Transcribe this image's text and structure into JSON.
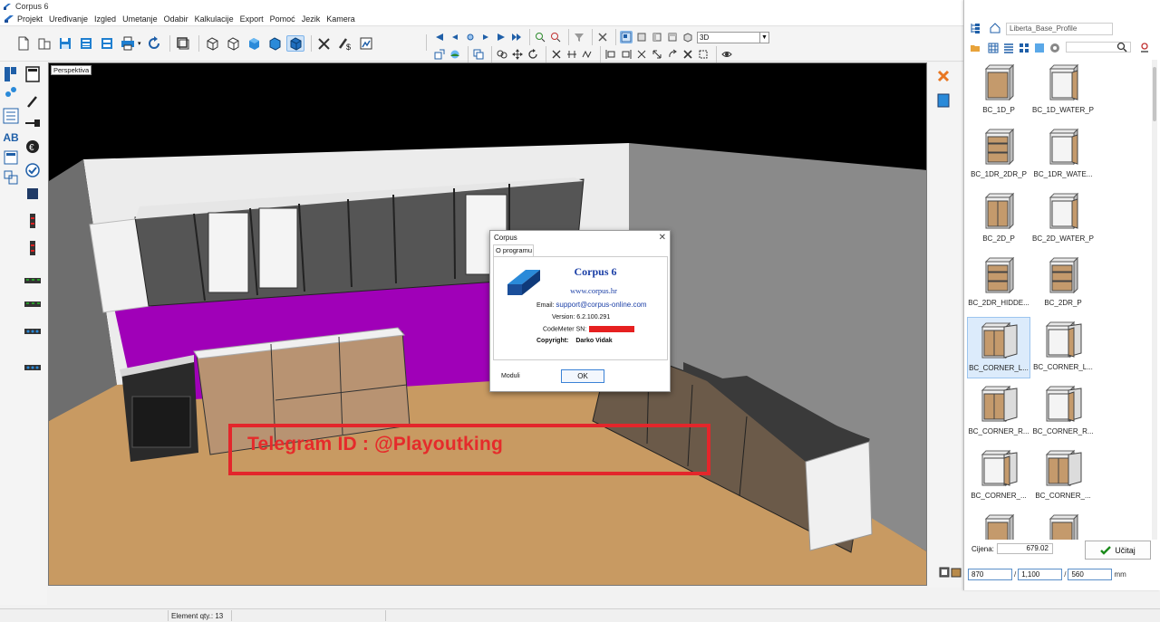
{
  "window": {
    "title": "Corpus 6"
  },
  "menu": [
    "Projekt",
    "Uređivanje",
    "Izgled",
    "Umetanje",
    "Odabir",
    "Kalkulacije",
    "Export",
    "Pomoć",
    "Jezik",
    "Kamera"
  ],
  "toolbar": {
    "view_mode": "3D"
  },
  "viewport": {
    "label": "Perspektiva"
  },
  "panel": {
    "profile": "Liberta_Base_Profile",
    "items": [
      {
        "label": "BC_1D_P",
        "icon": "cabinet-1-door-icon"
      },
      {
        "label": "BC_1D_WATER_P",
        "icon": "cabinet-1-door-open-icon"
      },
      {
        "label": "BC_1DR_2DR_P",
        "icon": "cabinet-drawers-icon"
      },
      {
        "label": "BC_1DR_WATE...",
        "icon": "cabinet-1-door-open-icon"
      },
      {
        "label": "BC_2D_P",
        "icon": "cabinet-2-door-icon"
      },
      {
        "label": "BC_2D_WATER_P",
        "icon": "cabinet-2-door-open-icon"
      },
      {
        "label": "BC_2DR_HIDDE...",
        "icon": "cabinet-drawers-icon"
      },
      {
        "label": "BC_2DR_P",
        "icon": "cabinet-drawers-icon"
      },
      {
        "label": "BC_CORNER_L...",
        "icon": "corner-cabinet-icon",
        "selected": true
      },
      {
        "label": "BC_CORNER_L...",
        "icon": "corner-cabinet-open-icon"
      },
      {
        "label": "BC_CORNER_R...",
        "icon": "corner-cabinet-icon"
      },
      {
        "label": "BC_CORNER_R...",
        "icon": "corner-cabinet-open-icon"
      },
      {
        "label": "BC_CORNER_...",
        "icon": "corner-cabinet-open-icon"
      },
      {
        "label": "BC_CORNER_...",
        "icon": "corner-cabinet-icon"
      },
      {
        "label": "",
        "icon": "cabinet-icon"
      },
      {
        "label": "",
        "icon": "cabinet-icon"
      }
    ],
    "price_label": "Cijena:",
    "price_value": "679.02",
    "load_button": "Učitaj",
    "dims": [
      "870",
      "1,100",
      "560"
    ],
    "dim_sep": "/",
    "dim_unit": "mm"
  },
  "dialog": {
    "title": "Corpus",
    "tab": "O programu",
    "product": "Corpus 6",
    "website": "www.corpus.hr",
    "email_label": "Email:",
    "email": "support@corpus-online.com",
    "version": "Version: 6.2.100.291",
    "codemeter_label": "CodeMeter SN:",
    "copyright_label": "Copyright:",
    "copyright_name": "Darko Vidak",
    "moduli": "Moduli",
    "ok": "OK"
  },
  "watermark": {
    "text": "Telegram ID : @Playoutking"
  },
  "status": {
    "element_qty": "Element qty.: 13"
  },
  "colors": {
    "accent": "#1b3fa6",
    "overlay_red": "#e3262b",
    "magenta_wall": "#a000b8",
    "floor": "#c89a62"
  }
}
